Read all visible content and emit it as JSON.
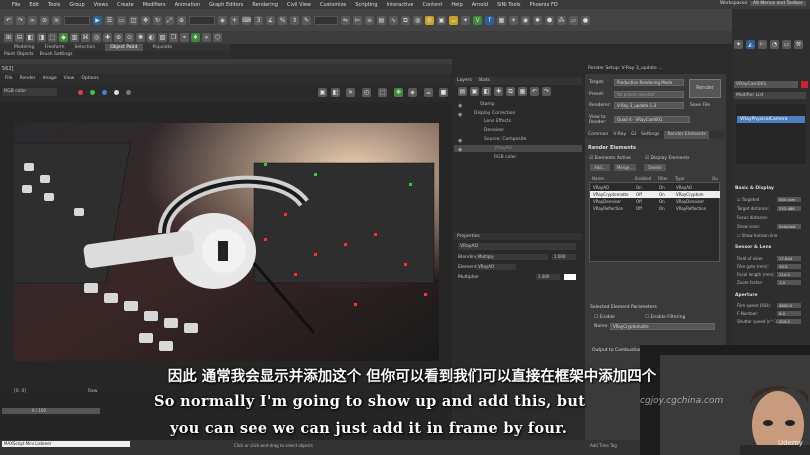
{
  "menu": [
    "File",
    "Edit",
    "Tools",
    "Group",
    "Views",
    "Create",
    "Modifiers",
    "Animation",
    "Graph Editors",
    "Rendering",
    "Civil View",
    "Customize",
    "Scripting",
    "Interactive",
    "Content",
    "Help",
    "Arnold",
    "SiNi Tools",
    "Phoenix FD"
  ],
  "workspaces": {
    "label": "Workspaces:",
    "value": "Alt Menus and Toolbar"
  },
  "ribbon_tabs": [
    "Modeling",
    "Freeform",
    "Selection",
    "Object Paint",
    "Populate"
  ],
  "ribbon_active": "Object Paint",
  "ribbon_sub": [
    "Paint Objects",
    "Brush Settings"
  ],
  "frame_window": {
    "title": "562]",
    "menu": [
      "File",
      "Render",
      "Image",
      "View",
      "Options"
    ],
    "channel": "RGB color",
    "coords": "[0, 0]",
    "raw": "Raw"
  },
  "layers": {
    "tabs": [
      "Layers",
      "Stats"
    ],
    "items": [
      "Stamp",
      "Display Correction",
      "Lens Effects",
      "Denoiser",
      "Source: Composite",
      "VRayAO",
      "RGB color"
    ],
    "properties_title": "Properties",
    "prop_name": "VRayAO",
    "blending_label": "Blending",
    "blending_value": "Multiply",
    "blending_amount": "1.000",
    "element_label": "Element",
    "element_value": "VRayAO",
    "multiplier_label": "Multiplier",
    "multiplier_value": "1.000"
  },
  "render_setup": {
    "title": "Render Setup: V-Ray 3_update ...",
    "target_label": "Target:",
    "target_value": "Production Rendering Mode",
    "preset_label": "Preset:",
    "preset_value": "No preset selected",
    "renderer_label": "Renderer:",
    "renderer_value": "V-Ray 3_update 1.3",
    "save_file": "Save File",
    "view_label": "View to Render:",
    "view_value": "Quad 4 - VRayCam001",
    "render_button": "Render",
    "tabs": [
      "Common",
      "V-Ray",
      "GI",
      "Settings",
      "Render Elements"
    ],
    "section": "Render Elements",
    "elements_active": "Elements Active",
    "display_elements": "Display Elements",
    "buttons": [
      "Add...",
      "Merge...",
      "Delete"
    ],
    "columns": [
      "Name",
      "Enabled",
      "Filter",
      "Type",
      "Ou"
    ],
    "rows": [
      [
        "VRayAO",
        "On",
        "On",
        "VRayAO"
      ],
      [
        "VRayCryptomatte",
        "Off",
        "On",
        "VRayCryptom"
      ],
      [
        "VRayDenoiser",
        "Off",
        "On",
        "VRayDenoiser"
      ],
      [
        "VRayReflection",
        "Off",
        "On",
        "VRayReflection"
      ]
    ],
    "selected_params": "Selected Element Parameters",
    "enable": "Enable",
    "enable_filtering": "Enable Filtering",
    "name_label": "Name:",
    "name_value": "VRayCryptomatte",
    "output": "Output to Combustion™"
  },
  "command_panel": {
    "object_name": "VRayCam001",
    "modifier_list": "Modifier List",
    "modifier": "VRayPhysicalCamera",
    "sections": [
      "Basic & Display",
      "Sensor & Lens",
      "Aperture"
    ],
    "targeted": "Targeted",
    "targeted_value": "Still cam",
    "target_distance": "Target distance:",
    "target_distance_value": "253.486",
    "focus_distance": "Focus distance:",
    "show_cone": "Show cone:",
    "show_cone_value": "Selected",
    "show_horizon": "Show horizon line",
    "fov": "Field of view:",
    "fov_value": "17.844",
    "film_gate": "Film gate (mm):",
    "film_gate_value": "36.0",
    "focal": "Focal length (mm):",
    "focal_value": "114.0",
    "zoom": "Zoom factor:",
    "zoom_value": "1.0",
    "film_speed": "Film speed (ISO):",
    "film_speed_value": "4600.0",
    "fnumber": "F-Number:",
    "fnumber_value": "8.0",
    "shutter": "Shutter speed (s^-1):",
    "shutter_value": "200.0"
  },
  "timeline": {
    "frame": "0 / 100"
  },
  "status": {
    "listener": "MAXScript Mini Listener",
    "hint": "Click or click-and-drag to select objects",
    "add_time_tag": "Add Time Tag"
  },
  "subtitles": {
    "zh": "因此 通常我会显示并添加这个 但你可以看到我们可以直接在框架中添加四个",
    "en1": "So normally I'm going to show up and add this, but",
    "en2": "you can see we can just add it in frame by four."
  },
  "watermark": "cgjoy.cgchina.com",
  "udemy": "Udemy",
  "colors": {
    "accent": "#3d6fa8",
    "selected": "#4d7fc0",
    "ui_bg": "#3a3a3a"
  }
}
